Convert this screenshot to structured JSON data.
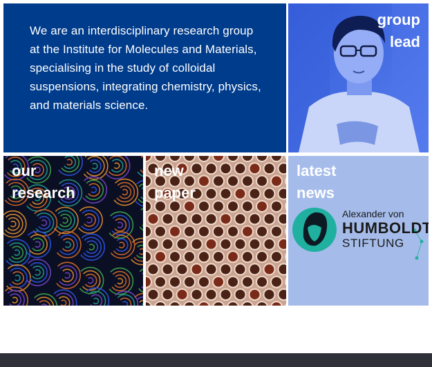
{
  "intro": {
    "text": "We are an interdisciplinary research group at the Institute for Molecules and Materials, specialising in the study of colloidal suspensions, integrating chemistry, physics, and materials science."
  },
  "tiles": {
    "group_lead": {
      "line1": "group",
      "line2": "lead"
    },
    "our_research": {
      "line1": "our",
      "line2": "research"
    },
    "new_paper": {
      "line1": "new",
      "line2": "paper"
    },
    "latest_news": {
      "line1": "latest",
      "line2": "news"
    }
  },
  "news_logo": {
    "line1": "Alexander von",
    "line2": "HUMBOLDT",
    "line3": "STIFTUNG",
    "accent_color": "#1fb0a0"
  },
  "colors": {
    "primary_blue": "#003c8c",
    "light_blue": "#a5bcea",
    "footer": "#2f3139"
  }
}
